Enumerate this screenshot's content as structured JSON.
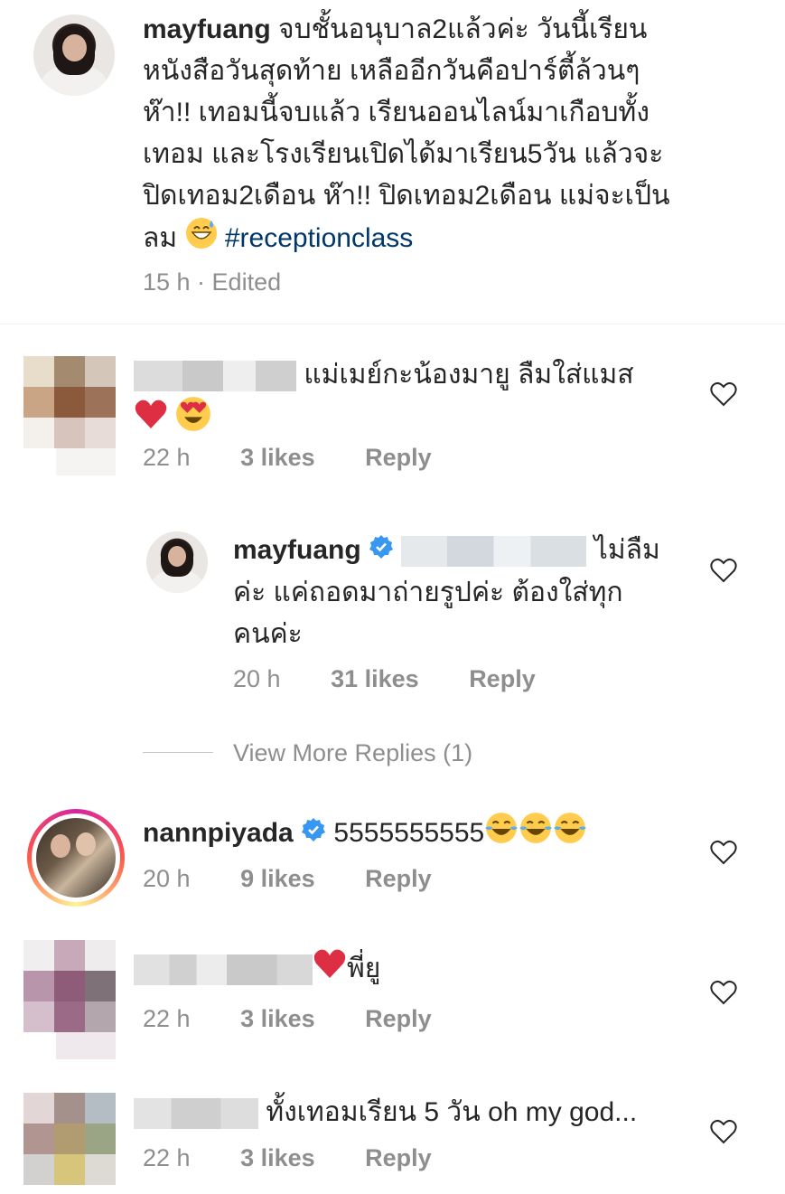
{
  "post": {
    "username": "mayfuang",
    "caption": "จบชั้นอนุบาล2แล้วค่ะ วันนี้เรียนหนังสือวันสุดท้าย เหลืออีกวันคือปาร์ตี้ล้วนๆ ห๊า!! เทอมนี้จบแล้ว เรียนออนไลน์มาเกือบทั้งเทอม และโรงเรียนเปิดได้มาเรียน5วัน แล้วจะปิดเทอม2เดือน ห๊า!! ปิดเทอม2เดือน แม่จะเป็นลม",
    "caption_lines": [
      "จบชั้นอนุบาล2แล้วค่ะ วันนี้เรียน",
      "หนังสือวันสุดท้าย เหลืออีกวันคือปาร์ตี้ล้วนๆ",
      "ห๊า!! เทอมนี้จบแล้ว เรียนออนไลน์มาเกือบทั้ง",
      "เทอม และโรงเรียนเปิดได้มาเรียน5วัน แล้วจะ",
      "ปิดเทอม2เดือน ห๊า!! ปิดเทอม2เดือน แม่จะเป็น",
      "ลม"
    ],
    "hashtag": "#receptionclass",
    "time": "15 h · Edited"
  },
  "comments": [
    {
      "text_line1": "แม่เมย์กะน้องมายู ลืมใส่แมส",
      "time": "22 h",
      "likes": "3 likes",
      "reply": "Reply"
    },
    {
      "username": "mayfuang",
      "text_line1": "ไม่ลืม",
      "text_line2": "ค่ะ แค่ถอดมาถ่ายรูปค่ะ ต้องใส่ทุก",
      "text_line3": "คนค่ะ",
      "time": "20 h",
      "likes": "31 likes",
      "reply": "Reply"
    },
    {
      "view_more": "View More Replies (1)"
    },
    {
      "username": "nannpiyada",
      "text": "5555555555",
      "time": "20 h",
      "likes": "9 likes",
      "reply": "Reply"
    },
    {
      "text": "พี่ยู",
      "time": "22 h",
      "likes": "3 likes",
      "reply": "Reply"
    },
    {
      "text": "ทั้งเทอมเรียน 5 วัน oh my god...",
      "time": "22 h",
      "likes": "3 likes",
      "reply": "Reply"
    }
  ],
  "colors": {
    "text": "#262626",
    "meta": "#8e8e8e",
    "hashtag": "#00376b",
    "verified": "#3897f0",
    "divider": "#efefef"
  },
  "icons": [
    "heart-outline-icon",
    "verified-badge-icon",
    "grinning-sweat-emoji",
    "red-heart-emoji",
    "heart-eyes-emoji",
    "tears-of-joy-emoji"
  ]
}
